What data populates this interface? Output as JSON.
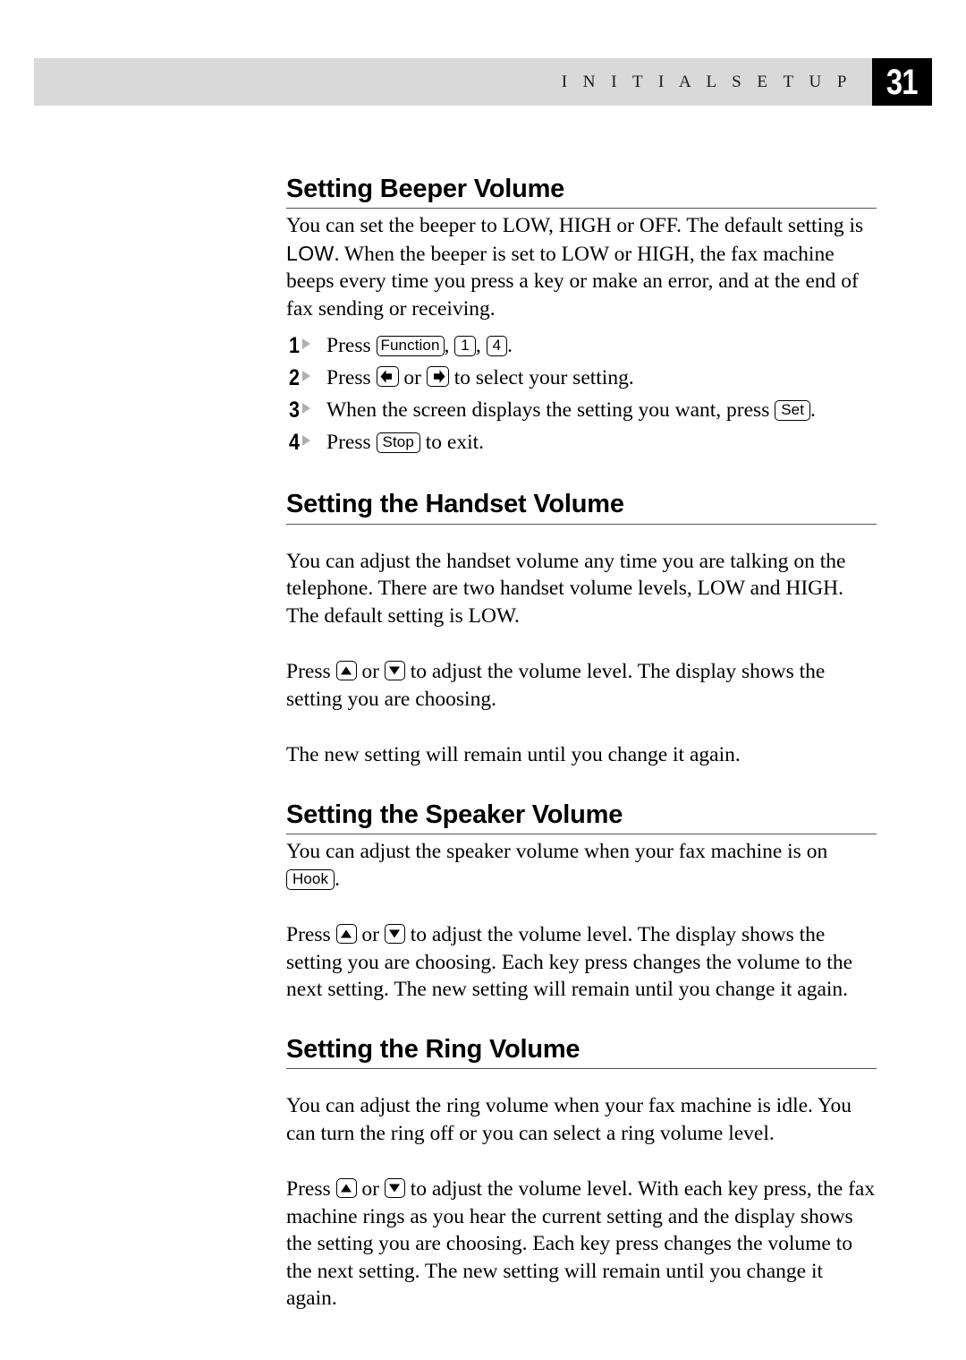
{
  "header": {
    "running_title": "I N I T I A L   S E T U P",
    "page_number": "31",
    "band_color": "#d9d9d9",
    "page_box_color": "#000000"
  },
  "sections": [
    {
      "id": "beeper-volume",
      "heading": "Setting Beeper Volume",
      "intro_lines": [
        "You can set the beeper to LOW, HIGH or OFF. The default setting is ",
        "When the beeper is set to LOW or HIGH, the fax machine beeps every time",
        "you press a key or make an error, and at the end of fax sending or receiving."
      ],
      "intro_lcd_value": "LOW",
      "intro_trailing": ".",
      "steps": [
        {
          "number": "1",
          "before": "Press ",
          "keys": [
            "Function",
            "1",
            "4"
          ],
          "after": "."
        },
        {
          "number": "2",
          "before": "Press ",
          "arrow_left": "left-arrow",
          "middle": " or ",
          "arrow_right": "right-arrow",
          "after": " to select your setting."
        },
        {
          "number": "3",
          "before": "When the screen displays the setting you want, press ",
          "keys": [
            "Set"
          ],
          "after": "."
        },
        {
          "number": "4",
          "before": "Press ",
          "keys": [
            "Stop"
          ],
          "after": " to exit."
        }
      ]
    },
    {
      "id": "handset-volume",
      "heading": "Setting the Handset Volume",
      "paragraphs": [
        "You can adjust the handset volume any time you are talking on the telephone. There are two handset volume levels, LOW and HIGH. The default setting is LOW."
      ],
      "press_paragraph": {
        "before": "Press ",
        "middle": " or ",
        "after": " to adjust the volume level.  The display shows the setting you are choosing."
      },
      "closing": "The new setting will remain until you change it again."
    },
    {
      "id": "speaker-volume",
      "heading": "Setting the Speaker Volume",
      "intro_before": "You can adjust the speaker volume when your fax machine is on ",
      "intro_key": "Hook",
      "intro_after": ".",
      "press_paragraph": {
        "before": "Press ",
        "middle": " or ",
        "after": " to adjust the volume level. The display shows the setting you are choosing.  Each key press changes the volume to the next setting. The new setting will remain until you change it again."
      }
    },
    {
      "id": "ring-volume",
      "heading": "Setting the Ring Volume",
      "paragraphs": [
        "You can adjust the ring volume when your fax machine is idle. You can turn the ring off or you can select a ring volume level."
      ],
      "press_paragraph": {
        "before": "Press ",
        "middle": " or ",
        "after": " to adjust the volume level. With each key press, the fax machine rings as you hear the current setting and the display shows the setting you are choosing.  Each key press changes the volume to the next setting. The new setting will remain until you change it again."
      }
    }
  ]
}
